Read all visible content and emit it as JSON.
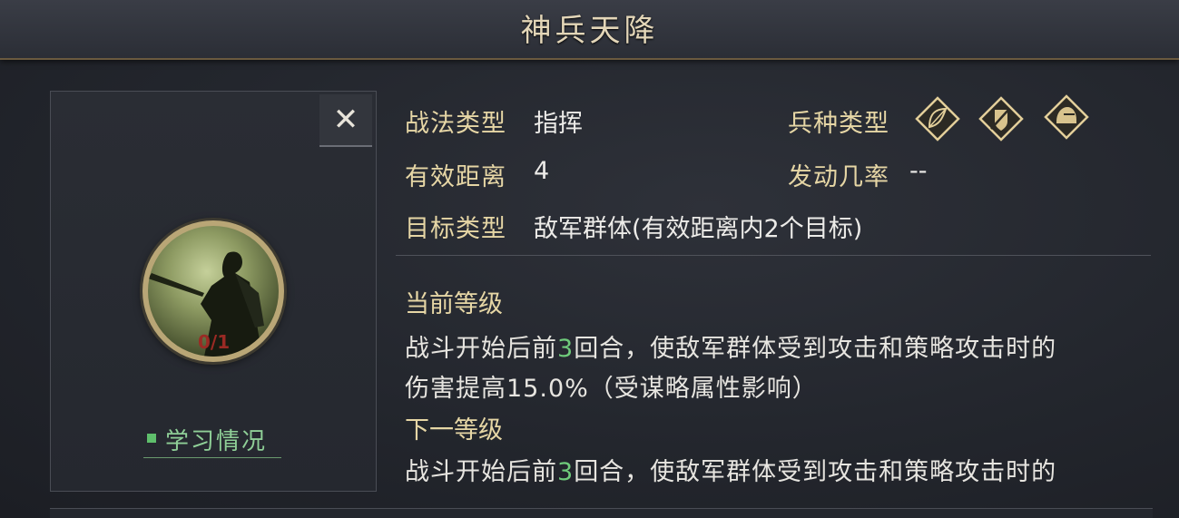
{
  "title": "神兵天降",
  "close_symbol": "✕",
  "portrait": {
    "count": "0/1"
  },
  "study_label": "学习情况",
  "info": {
    "type_label": "战法类型",
    "type_value": "指挥",
    "range_label": "有效距离",
    "range_value": "4",
    "target_label": "目标类型",
    "target_value": "敌军群体(有效距离内2个目标)",
    "troop_label": "兵种类型",
    "troop_icons": [
      "bow-icon",
      "shield-icon",
      "cavalry-helmet-icon"
    ],
    "rate_label": "发动几率",
    "rate_value": "--"
  },
  "current": {
    "title": "当前等级",
    "line1_pre": "战斗开始后前",
    "line1_num": "3",
    "line1_post": "回合，使敌军群体受到攻击和策略攻击时的",
    "line2": "伤害提高15.0%（受谋略属性影响）"
  },
  "next": {
    "title": "下一等级",
    "line1_pre": "战斗开始后前",
    "line1_num": "3",
    "line1_post": "回合，使敌军群体受到攻击和策略攻击时的"
  },
  "colors": {
    "accent_gold": "#e6d6a5",
    "highlight_green": "#6fcb7b",
    "background": "#23262d"
  }
}
